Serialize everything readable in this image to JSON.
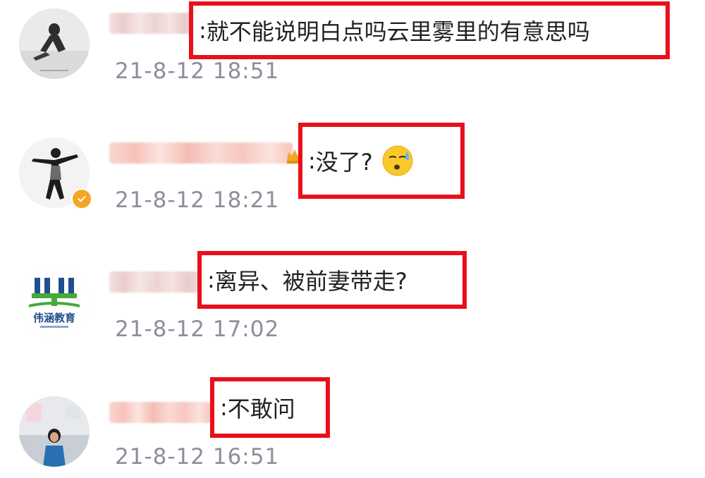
{
  "comments": [
    {
      "text": "就不能说明白点吗云里雾里的有意思吗",
      "timestamp": "21-8-12 18:51",
      "avatar_icon": "dancer-photo-avatar"
    },
    {
      "text": "没了?",
      "emoji": "sweat-face-emoji",
      "timestamp": "21-8-12 18:21",
      "avatar_icon": "dancer-silhouette-avatar",
      "badges": [
        "crown-icon",
        "verified-badge"
      ]
    },
    {
      "text": "离异、被前妻带走?",
      "timestamp": "21-8-12 17:02",
      "avatar_icon": "school-logo-avatar",
      "avatar_logo_text": "伟涵教育"
    },
    {
      "text": "不敢问",
      "timestamp": "21-8-12 16:51",
      "avatar_icon": "girl-photo-avatar"
    }
  ],
  "separator": ":",
  "colors": {
    "highlight_box": "#e8101b",
    "timestamp": "#8a8f99",
    "text": "#222222",
    "verified": "#f5a623"
  }
}
